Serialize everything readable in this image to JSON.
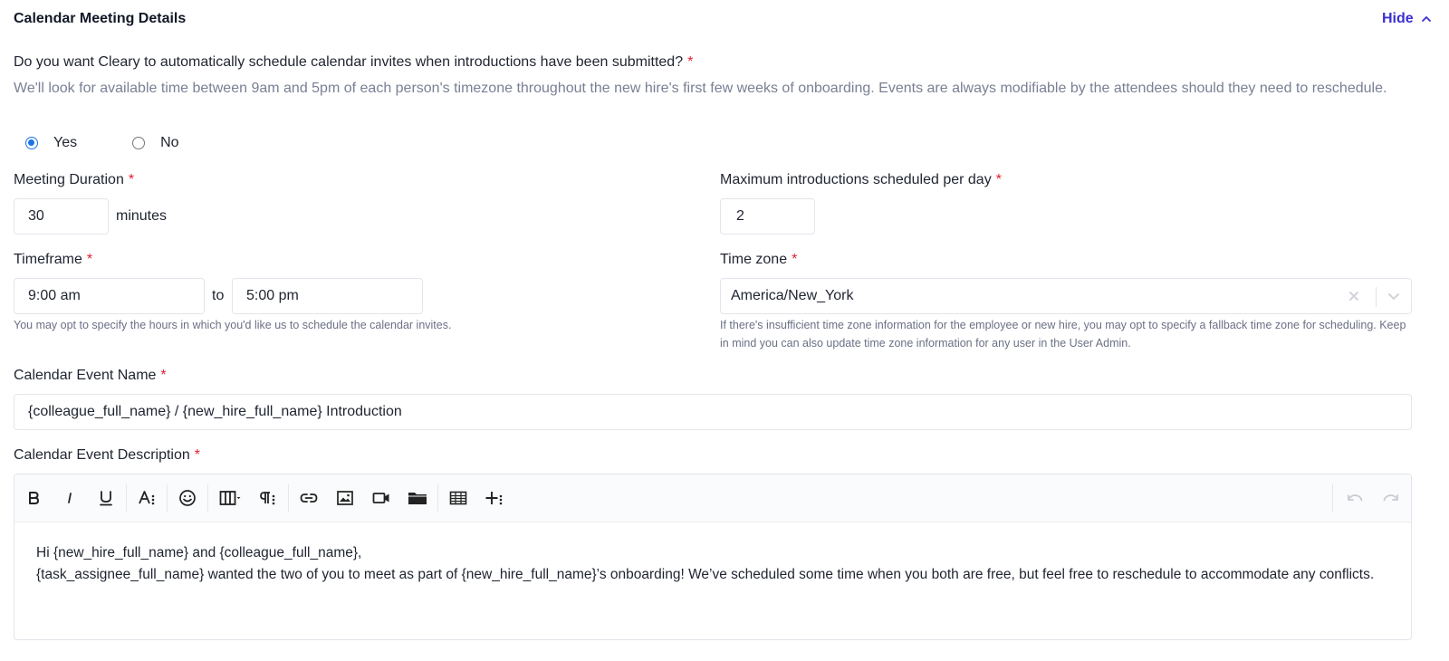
{
  "section": {
    "title": "Calendar Meeting Details",
    "hide_label": "Hide"
  },
  "schedule_question": {
    "label": "Do you want Cleary to automatically schedule calendar invites when introductions have been submitted?",
    "required": "*",
    "description": "We'll look for available time between 9am and 5pm of each person's timezone throughout the new hire's first few weeks of onboarding. Events are always modifiable by the attendees should they need to reschedule.",
    "options": [
      {
        "label": "Yes",
        "checked": true
      },
      {
        "label": "No",
        "checked": false
      }
    ]
  },
  "meeting_duration": {
    "label": "Meeting Duration",
    "required": "*",
    "value": "30",
    "unit": "minutes"
  },
  "max_intros": {
    "label": "Maximum introductions scheduled per day",
    "required": "*",
    "value": "2"
  },
  "timeframe": {
    "label": "Timeframe",
    "required": "*",
    "start": "9:00 am",
    "separator": "to",
    "end": "5:00 pm",
    "help": "You may opt to specify the hours in which you'd like us to schedule the calendar invites."
  },
  "time_zone": {
    "label": "Time zone",
    "required": "*",
    "value": "America/New_York",
    "help": "If there's insufficient time zone information for the employee or new hire, you may opt to specify a fallback time zone for scheduling. Keep in mind you can also update time zone information for any user in the User Admin."
  },
  "event_name": {
    "label": "Calendar Event Name",
    "required": "*",
    "value": "{colleague_full_name} / {new_hire_full_name} Introduction"
  },
  "event_description": {
    "label": "Calendar Event Description",
    "required": "*",
    "toolbar_icons": [
      "bold-icon",
      "italic-icon",
      "underline-icon",
      "font-size-icon",
      "emoji-icon",
      "columns-icon",
      "paragraph-format-icon",
      "link-icon",
      "image-icon",
      "video-icon",
      "folder-icon",
      "table-icon",
      "insert-more-icon",
      "undo-icon",
      "redo-icon"
    ],
    "line1": "Hi {new_hire_full_name} and {colleague_full_name},",
    "line2": "{task_assignee_full_name} wanted the two of you to meet as part of {new_hire_full_name}’s onboarding! We’ve scheduled some time when you both are free, but feel free to reschedule to accommodate any conflicts."
  },
  "colors": {
    "accent": "#3b2fd1",
    "required": "#e11d2e",
    "radio": "#1a73e8"
  }
}
